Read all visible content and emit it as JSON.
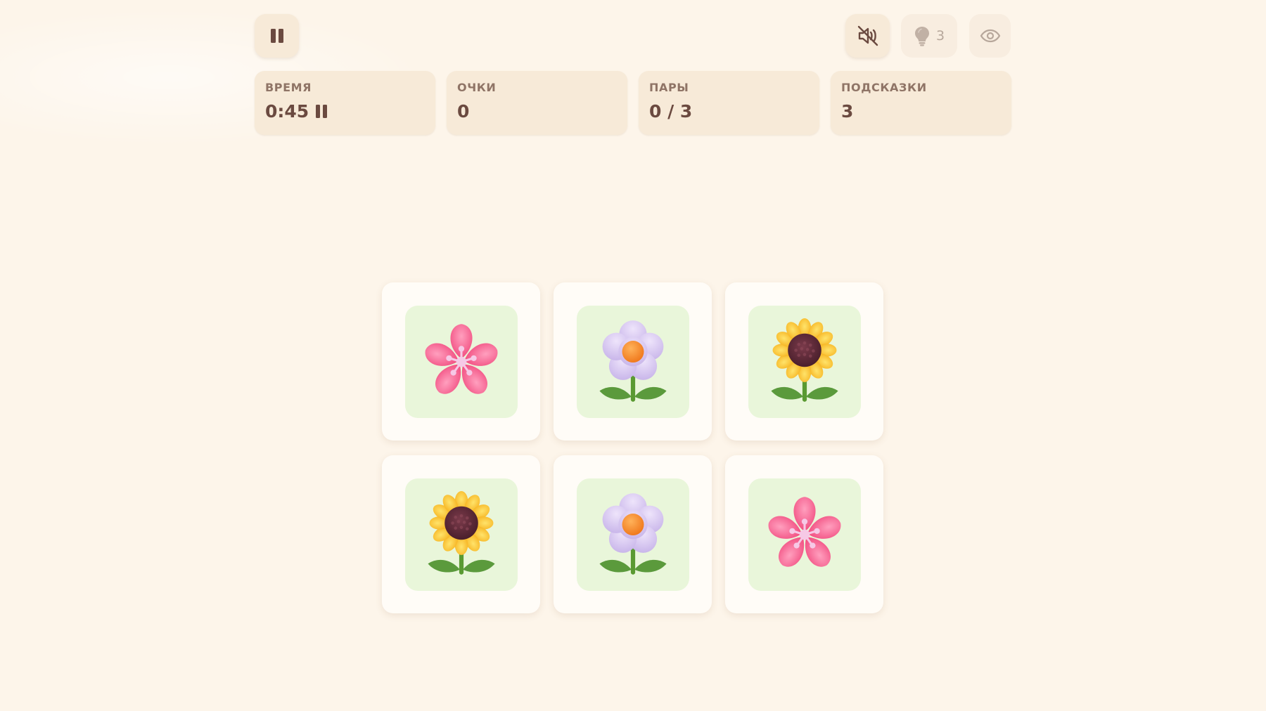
{
  "toolbar": {
    "pause_icon": "pause-icon",
    "mute_icon": "speaker-muted-icon",
    "hint_icon": "lightbulb-icon",
    "hint_count": "3",
    "peek_icon": "eye-icon"
  },
  "stats": [
    {
      "label": "ВРЕМЯ",
      "value": "0:45",
      "status_icon": "pause-icon"
    },
    {
      "label": "ОЧКИ",
      "value": "0"
    },
    {
      "label": "ПАРЫ",
      "value": "0 / 3"
    },
    {
      "label": "ПОДСКАЗКИ",
      "value": "3"
    }
  ],
  "board": {
    "rows": 2,
    "columns": 3,
    "cards": [
      {
        "symbol": "cherry-blossom-icon",
        "face_up": true
      },
      {
        "symbol": "lilac-flower-icon",
        "face_up": true
      },
      {
        "symbol": "sunflower-icon",
        "face_up": true
      },
      {
        "symbol": "sunflower-icon",
        "face_up": true
      },
      {
        "symbol": "lilac-flower-icon",
        "face_up": true
      },
      {
        "symbol": "cherry-blossom-icon",
        "face_up": true
      }
    ]
  },
  "colors": {
    "background": "#fdf5ea",
    "panel": "#f7ead8",
    "card": "#fffcf7",
    "card_face": "#e9f6da",
    "text": "#6b4a40",
    "label": "#8f7466"
  }
}
